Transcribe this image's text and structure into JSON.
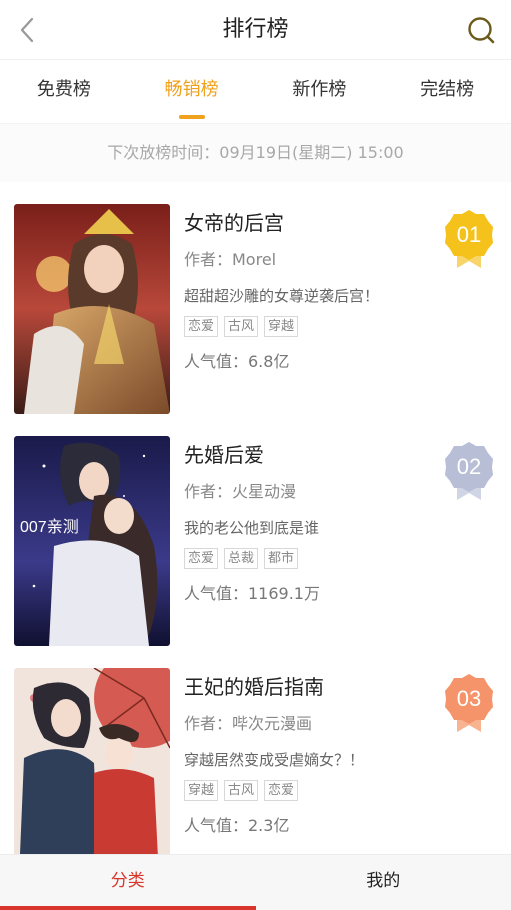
{
  "header": {
    "title": "排行榜",
    "back_icon": "chevron-left-icon",
    "search_icon": "search-icon"
  },
  "tabs": [
    {
      "label": "免费榜",
      "active": false
    },
    {
      "label": "畅销榜",
      "active": true
    },
    {
      "label": "新作榜",
      "active": false
    },
    {
      "label": "完结榜",
      "active": false
    }
  ],
  "notice": "下次放榜时间：09月19日(星期二) 15:00",
  "books": [
    {
      "rank": "01",
      "title": "女帝的后宫",
      "author": "作者：Morel",
      "desc": "超甜超沙雕的女尊逆袭后宫！",
      "tags": [
        "恋爱",
        "古风",
        "穿越"
      ],
      "popularity": "人气值：6.8亿",
      "badge_color": "#f5c21b"
    },
    {
      "rank": "02",
      "title": "先婚后爱",
      "author": "作者：火星动漫",
      "desc": "我的老公他到底是谁",
      "tags": [
        "恋爱",
        "总裁",
        "都市"
      ],
      "popularity": "人气值：1169.1万",
      "badge_color": "#b7bed6",
      "cover_text": "007亲测"
    },
    {
      "rank": "03",
      "title": "王妃的婚后指南",
      "author": "作者：哔次元漫画",
      "desc": "穿越居然变成受虐嫡女？！",
      "tags": [
        "穿越",
        "古风",
        "恋爱"
      ],
      "popularity": "人气值：2.3亿",
      "badge_color": "#f5946a"
    }
  ],
  "bottom_nav": [
    {
      "label": "分类",
      "active": true
    },
    {
      "label": "我的",
      "active": false
    }
  ],
  "colors": {
    "accent": "#f0a11e",
    "nav_active": "#d9352a"
  }
}
